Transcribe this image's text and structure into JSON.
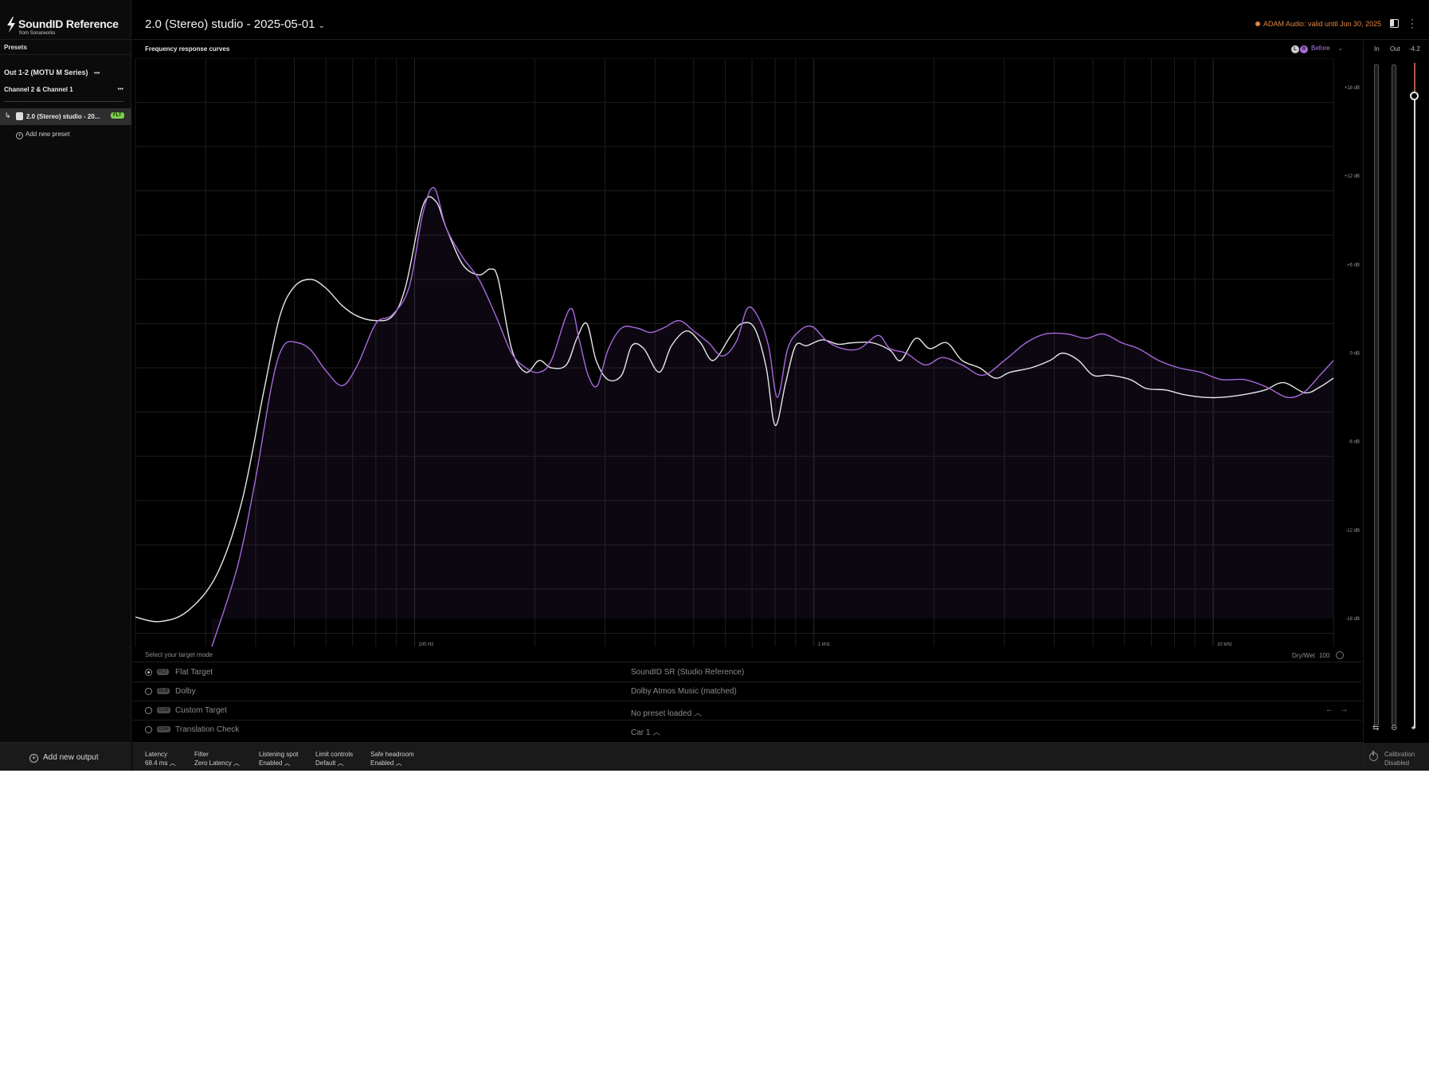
{
  "app": {
    "name": "SoundID Reference",
    "subtitle": "from Sonarworks",
    "window_controls": "–  ×"
  },
  "sidebar": {
    "section_title": "Presets",
    "output_label": "Out 1-2 (MOTU M Series)",
    "channel_label": "Channel 2 & Channel 1",
    "preset_item": {
      "label": "2.0 (Stereo) studio - 20...",
      "badge": "FLT"
    },
    "add_preset_label": "Add new preset",
    "add_output_label": "Add new output",
    "more_glyph": "•••"
  },
  "header": {
    "preset_title": "2.0 (Stereo) studio - 2025-05-01",
    "license_text": "ADAM Audio: valid until Jun 30, 2025",
    "license_color": "#e3833e"
  },
  "chart": {
    "title": "Frequency response curves",
    "toggle_label": "Before",
    "channel_l": "L",
    "channel_r": "R"
  },
  "chart_data": {
    "type": "line",
    "x_scale": "log",
    "xlim": [
      20,
      20000
    ],
    "ylim": [
      -20,
      20
    ],
    "y_ticks": [
      {
        "value": 18,
        "label": "+18 dB"
      },
      {
        "value": 12,
        "label": "+12 dB"
      },
      {
        "value": 6,
        "label": "+6 dB"
      },
      {
        "value": 0,
        "label": "0 dB"
      },
      {
        "value": -6,
        "label": "-6 dB"
      },
      {
        "value": -12,
        "label": "-12 dB"
      },
      {
        "value": -18,
        "label": "-18 dB"
      }
    ],
    "x_ticks": [
      {
        "value": 100,
        "label": "100 Hz"
      },
      {
        "value": 1000,
        "label": "1 kHz"
      },
      {
        "value": 10000,
        "label": "10 kHz"
      }
    ],
    "grid": true,
    "series": [
      {
        "color": "#e8e8e8",
        "points": [
          [
            20,
            -17.9
          ],
          [
            23,
            -18.2
          ],
          [
            27,
            -17.5
          ],
          [
            32,
            -15.0
          ],
          [
            37,
            -10.0
          ],
          [
            42,
            -2.5
          ],
          [
            46,
            2.5
          ],
          [
            50,
            4.5
          ],
          [
            55,
            5.0
          ],
          [
            60,
            4.4
          ],
          [
            66,
            3.2
          ],
          [
            72,
            2.5
          ],
          [
            80,
            2.2
          ],
          [
            88,
            2.5
          ],
          [
            95,
            4.5
          ],
          [
            105,
            10.0
          ],
          [
            113,
            10.3
          ],
          [
            120,
            8.5
          ],
          [
            132,
            6.0
          ],
          [
            145,
            5.3
          ],
          [
            155,
            5.7
          ],
          [
            162,
            5.0
          ],
          [
            175,
            0.3
          ],
          [
            190,
            -1.3
          ],
          [
            205,
            -0.5
          ],
          [
            220,
            -1.0
          ],
          [
            240,
            -0.8
          ],
          [
            255,
            1.0
          ],
          [
            270,
            2.0
          ],
          [
            285,
            -0.5
          ],
          [
            305,
            -1.8
          ],
          [
            330,
            -1.5
          ],
          [
            350,
            0.5
          ],
          [
            375,
            0.3
          ],
          [
            410,
            -1.3
          ],
          [
            440,
            0.5
          ],
          [
            480,
            1.5
          ],
          [
            520,
            0.7
          ],
          [
            560,
            -0.5
          ],
          [
            620,
            1.2
          ],
          [
            660,
            2.0
          ],
          [
            710,
            1.7
          ],
          [
            760,
            -1.0
          ],
          [
            800,
            -4.9
          ],
          [
            850,
            -2.0
          ],
          [
            900,
            0.5
          ],
          [
            960,
            0.5
          ],
          [
            1050,
            0.9
          ],
          [
            1150,
            0.6
          ],
          [
            1250,
            0.7
          ],
          [
            1400,
            0.7
          ],
          [
            1550,
            0.2
          ],
          [
            1650,
            -0.5
          ],
          [
            1800,
            1.0
          ],
          [
            1950,
            0.3
          ],
          [
            2150,
            0.7
          ],
          [
            2350,
            -0.5
          ],
          [
            2600,
            -1.0
          ],
          [
            2850,
            -1.7
          ],
          [
            3100,
            -1.3
          ],
          [
            3500,
            -1.0
          ],
          [
            3900,
            -0.5
          ],
          [
            4200,
            0.0
          ],
          [
            4600,
            -0.5
          ],
          [
            5000,
            -1.5
          ],
          [
            5500,
            -1.5
          ],
          [
            6200,
            -1.8
          ],
          [
            6800,
            -2.4
          ],
          [
            7600,
            -2.5
          ],
          [
            8400,
            -2.8
          ],
          [
            9500,
            -3.0
          ],
          [
            10500,
            -3.0
          ],
          [
            12000,
            -2.8
          ],
          [
            13500,
            -2.5
          ],
          [
            15000,
            -2.0
          ],
          [
            17000,
            -2.7
          ],
          [
            18500,
            -2.3
          ],
          [
            20000,
            -1.7
          ]
        ]
      },
      {
        "color": "#a869dc",
        "points": [
          [
            31,
            -20.0
          ],
          [
            36,
            -14.5
          ],
          [
            40,
            -8.5
          ],
          [
            44,
            -2.0
          ],
          [
            47,
            0.5
          ],
          [
            51,
            0.7
          ],
          [
            55,
            0.2
          ],
          [
            60,
            -1.2
          ],
          [
            66,
            -2.2
          ],
          [
            72,
            -0.8
          ],
          [
            80,
            2.0
          ],
          [
            88,
            2.6
          ],
          [
            97,
            4.5
          ],
          [
            105,
            9.5
          ],
          [
            112,
            11.2
          ],
          [
            120,
            8.5
          ],
          [
            132,
            6.5
          ],
          [
            145,
            5.0
          ],
          [
            160,
            2.5
          ],
          [
            175,
            0.0
          ],
          [
            190,
            -1.0
          ],
          [
            205,
            -1.3
          ],
          [
            220,
            -0.5
          ],
          [
            245,
            3.0
          ],
          [
            258,
            1.0
          ],
          [
            272,
            -1.5
          ],
          [
            287,
            -2.2
          ],
          [
            305,
            0.2
          ],
          [
            330,
            1.7
          ],
          [
            360,
            1.7
          ],
          [
            390,
            1.4
          ],
          [
            420,
            1.7
          ],
          [
            460,
            2.2
          ],
          [
            500,
            1.5
          ],
          [
            545,
            0.7
          ],
          [
            590,
            -0.2
          ],
          [
            640,
            0.8
          ],
          [
            680,
            3.0
          ],
          [
            720,
            2.6
          ],
          [
            770,
            0.5
          ],
          [
            810,
            -3.0
          ],
          [
            860,
            0.3
          ],
          [
            920,
            1.5
          ],
          [
            990,
            1.8
          ],
          [
            1080,
            0.8
          ],
          [
            1180,
            0.3
          ],
          [
            1300,
            0.3
          ],
          [
            1450,
            1.2
          ],
          [
            1550,
            0.3
          ],
          [
            1700,
            0.0
          ],
          [
            1900,
            -0.8
          ],
          [
            2100,
            -0.3
          ],
          [
            2350,
            -0.8
          ],
          [
            2650,
            -1.5
          ],
          [
            3000,
            -0.5
          ],
          [
            3400,
            0.7
          ],
          [
            3800,
            1.3
          ],
          [
            4300,
            1.3
          ],
          [
            4800,
            1.0
          ],
          [
            5300,
            1.3
          ],
          [
            5900,
            0.7
          ],
          [
            6500,
            0.3
          ],
          [
            7300,
            -0.5
          ],
          [
            8200,
            -1.0
          ],
          [
            9300,
            -1.3
          ],
          [
            10500,
            -1.8
          ],
          [
            12000,
            -1.8
          ],
          [
            13600,
            -2.3
          ],
          [
            15300,
            -3.0
          ],
          [
            16800,
            -2.7
          ],
          [
            18500,
            -1.5
          ],
          [
            20000,
            -0.5
          ]
        ]
      }
    ]
  },
  "target": {
    "header": "Select your target mode",
    "drywet_label": "Dry/Wet",
    "drywet_value": "100",
    "rows": [
      {
        "code": "FLT",
        "name": "Flat Target",
        "value": "SoundID SR (Studio Reference)"
      },
      {
        "code": "DLB",
        "name": "Dolby",
        "value": "Dolby Atmos Music (matched)"
      },
      {
        "code": "CUS",
        "name": "Custom Target",
        "value": "No preset loaded"
      },
      {
        "code": "CHK",
        "name": "Translation Check",
        "value": "Car 1"
      }
    ]
  },
  "status": {
    "latency": {
      "label": "Latency",
      "value": "68.4 ms"
    },
    "filter": {
      "label": "Filter",
      "value": "Zero Latency"
    },
    "listening_spot": {
      "label": "Listening spot",
      "value": "Enabled"
    },
    "limit_controls": {
      "label": "Limit controls",
      "value": "Default"
    },
    "safe_headroom": {
      "label": "Safe headroom",
      "value": "Enabled"
    }
  },
  "meters": {
    "in_label": "In",
    "out_label": "Out",
    "volume_value": "-4.2",
    "calibration_label": "Calibration",
    "calibration_state": "Disabled"
  }
}
